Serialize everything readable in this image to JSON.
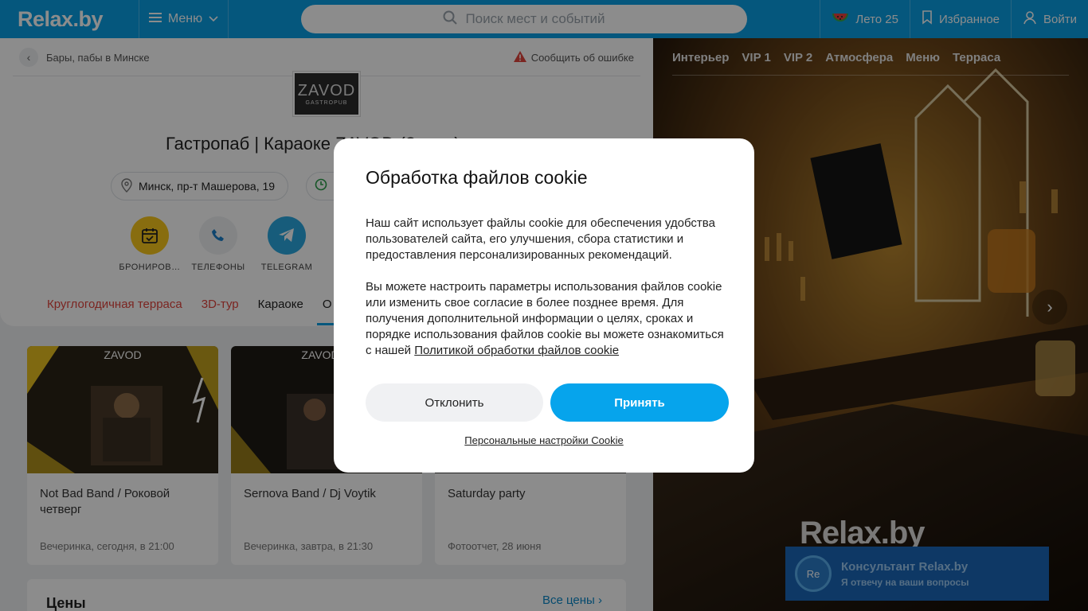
{
  "header": {
    "logo": "Relax.by",
    "menu_label": "Меню",
    "search_placeholder": "Поиск мест и событий",
    "summer_label": "Лето 25",
    "favorites_label": "Избранное",
    "login_label": "Войти"
  },
  "breadcrumb": {
    "label": "Бары, пабы в Минске"
  },
  "report_label": "Сообщить об ошибке",
  "venue": {
    "logo_text": "ZAVOD",
    "logo_sub": "GASTROPUB",
    "title": "Гастропаб | Караоке ZAVOD (Завод)",
    "address": "Минск, пр-т Машерова, 19"
  },
  "actions": [
    {
      "label": "БРОНИРОВ…",
      "icon": "calendar-check-icon",
      "color": "#f7c61c"
    },
    {
      "label": "ТЕЛЕФОНЫ",
      "icon": "phone-icon",
      "color": "#eef0f3"
    },
    {
      "label": "TELEGRAM",
      "icon": "telegram-icon",
      "color": "#2aa8e0"
    }
  ],
  "tabs": [
    "Круглогодичная терраса",
    "3D-тур",
    "Караоке",
    "О"
  ],
  "events": [
    {
      "title": "Not Bad Band / Роковой четверг",
      "meta": "Вечеринка, сегодня, в 21:00",
      "poster_brand": "ZAVOD"
    },
    {
      "title": "Sernova Band / Dj Voytik",
      "meta": "Вечеринка, завтра, в 21:30",
      "poster_brand": "ZAVOD"
    },
    {
      "title": "Saturday party",
      "meta": "Фотоотчет, 28 июня",
      "poster_brand": ""
    }
  ],
  "prices": {
    "title": "Цены",
    "link": "Все цены"
  },
  "gallery": {
    "tabs": [
      "Интерьер",
      "VIP 1",
      "VIP 2",
      "Атмосфера",
      "Меню",
      "Терраса"
    ],
    "watermark": "Relax.by"
  },
  "consultant": {
    "avatar": "Re",
    "name": "Консультант Relax.by",
    "subtitle": "Я отвечу на ваши вопросы"
  },
  "cookie": {
    "title": "Обработка файлов cookie",
    "para1": "Наш сайт использует файлы cookie для обеспечения удобства пользователей сайта, его улучшения, сбора статистики и предоставления персонализированных рекомендаций.",
    "para2": "Вы можете настроить параметры использования файлов cookie или изменить свое согласие в более позднее время. Для получения дополнительной информации о целях, сроках и порядке использования файлов cookie вы можете ознакомиться с нашей ",
    "policy_link": "Политикой обработки файлов cookie",
    "decline": "Отклонить",
    "accept": "Принять",
    "settings": "Персональные настройки Cookie"
  },
  "colors": {
    "brand": "#0a9fe4",
    "accept": "#06a4ec",
    "tab_red": "#e0443d",
    "consultant": "#1a66b8"
  }
}
